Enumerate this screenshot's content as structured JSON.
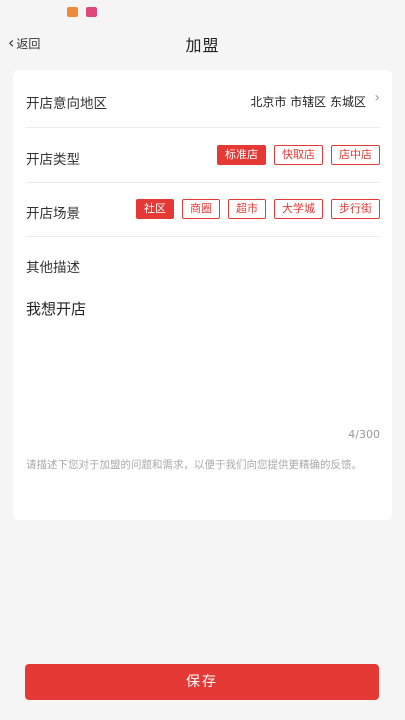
{
  "header": {
    "back_label": "返回",
    "title": "加盟"
  },
  "form": {
    "region": {
      "label": "开店意向地区",
      "value": "北京市 市辖区 东城区"
    },
    "store_type": {
      "label": "开店类型",
      "selected": "标准店",
      "options": [
        "标准店",
        "快取店",
        "店中店"
      ]
    },
    "scene": {
      "label": "开店场景",
      "selected": "社区",
      "options": [
        "社区",
        "商圈",
        "超市",
        "大学城",
        "步行街"
      ]
    },
    "description": {
      "label": "其他描述",
      "value": "我想开店",
      "count": "4/300",
      "hint": "请描述下您对于加盟的问题和需求，以便于我们向您提供更精确的反馈。"
    }
  },
  "footer": {
    "save_label": "保存"
  },
  "colors": {
    "accent": "#e53935",
    "background": "#f5f5f5"
  }
}
